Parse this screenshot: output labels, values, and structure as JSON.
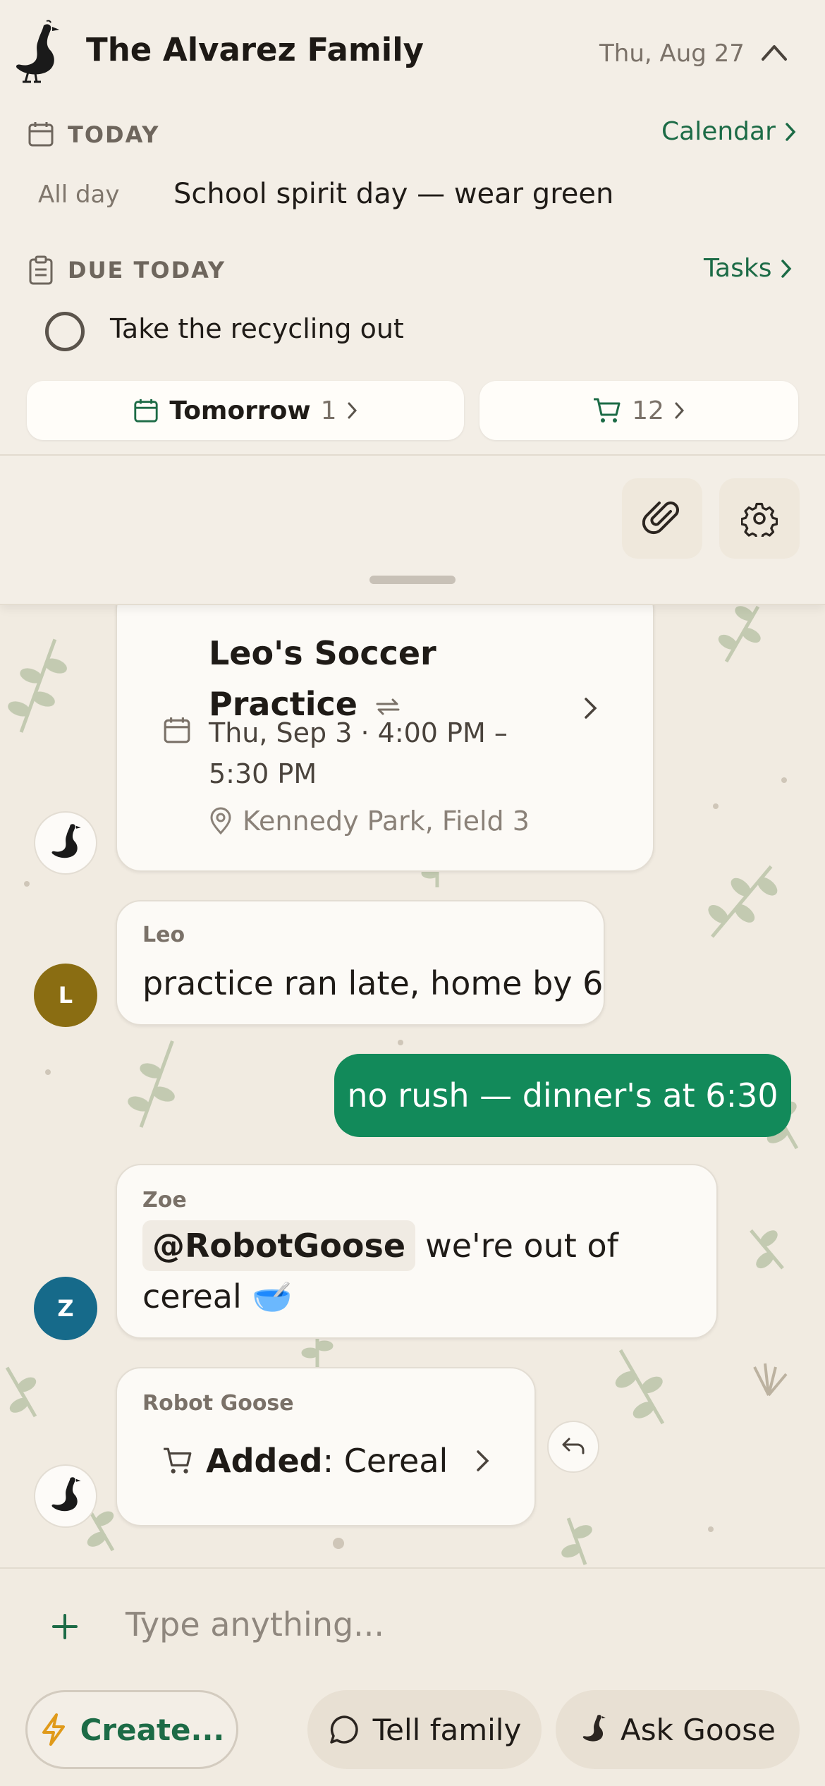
{
  "header": {
    "title": "The Alvarez Family",
    "date": "Thu, Aug 27"
  },
  "today": {
    "label": "TODAY",
    "link": "Calendar",
    "event_time": "All day",
    "event_text": "School spirit day — wear green"
  },
  "due": {
    "label": "DUE TODAY",
    "link": "Tasks",
    "task": "Take the recycling out"
  },
  "pills": {
    "tomorrow_label": "Tomorrow",
    "tomorrow_count": "1",
    "cart_count": "12"
  },
  "event_card": {
    "title_line1": "Leo's Soccer",
    "title_line2": "Practice",
    "time_line1": "Thu, Sep 3 · 4:00 PM –",
    "time_line2": "5:30 PM",
    "location": "Kennedy Park, Field 3"
  },
  "messages": [
    {
      "sender": "Leo",
      "avatar": "L",
      "text": "practice ran late, home by 6",
      "color": "#8a6d12"
    },
    {
      "text": "no rush — dinner's at 6:30"
    },
    {
      "sender": "Zoe",
      "avatar": "Z",
      "mention": "@RobotGoose",
      "text_after_mention": "we're out of",
      "text_line2": "cereal 🥣",
      "color": "#166a8a"
    },
    {
      "sender": "Robot Goose",
      "added_label": "Added",
      "added_item": ": Cereal"
    }
  ],
  "composer": {
    "placeholder": "Type anything...",
    "create": "Create...",
    "tell_family": "Tell family",
    "ask_goose": "Ask Goose"
  },
  "colors": {
    "accent_green": "#1c6b46",
    "sent_bubble": "#128a5a",
    "create_icon": "#e09a1a"
  }
}
